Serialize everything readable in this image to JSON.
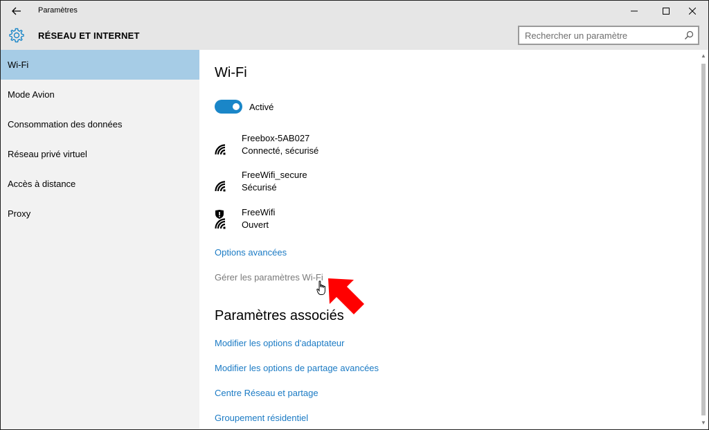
{
  "window": {
    "title": "Paramètres",
    "back_icon": "back-arrow-icon",
    "controls": {
      "minimize": "—",
      "maximize": "☐",
      "close": "✕"
    }
  },
  "header": {
    "icon": "gear-icon",
    "section_title": "RÉSEAU ET INTERNET",
    "search_placeholder": "Rechercher un paramètre"
  },
  "sidebar": {
    "items": [
      {
        "label": "Wi-Fi",
        "selected": true
      },
      {
        "label": "Mode Avion",
        "selected": false
      },
      {
        "label": "Consommation des données",
        "selected": false
      },
      {
        "label": "Réseau privé virtuel",
        "selected": false
      },
      {
        "label": "Accès à distance",
        "selected": false
      },
      {
        "label": "Proxy",
        "selected": false
      }
    ]
  },
  "main": {
    "title": "Wi-Fi",
    "toggle": {
      "label": "Activé",
      "on": true
    },
    "networks": [
      {
        "name": "Freebox-5AB027",
        "status": "Connecté, sécurisé",
        "icon": "wifi-icon"
      },
      {
        "name": "FreeWifi_secure",
        "status": "Sécurisé",
        "icon": "wifi-icon"
      },
      {
        "name": "FreeWifi",
        "status": "Ouvert",
        "icon": "wifi-warning-icon"
      }
    ],
    "advanced_link": "Options avancées",
    "manage_link": "Gérer les paramètres Wi-Fi",
    "related_title": "Paramètres associés",
    "related_links": [
      "Modifier les options d'adaptateur",
      "Modifier les options de partage avancées",
      "Centre Réseau et partage",
      "Groupement résidentiel"
    ]
  },
  "colors": {
    "accent": "#1a86c8",
    "link": "#1a7ac4",
    "selected_nav": "#a6cce6",
    "header_bg": "#e6e6e6",
    "sidebar_bg": "#f2f2f2",
    "annotation_arrow": "#ff0000"
  }
}
